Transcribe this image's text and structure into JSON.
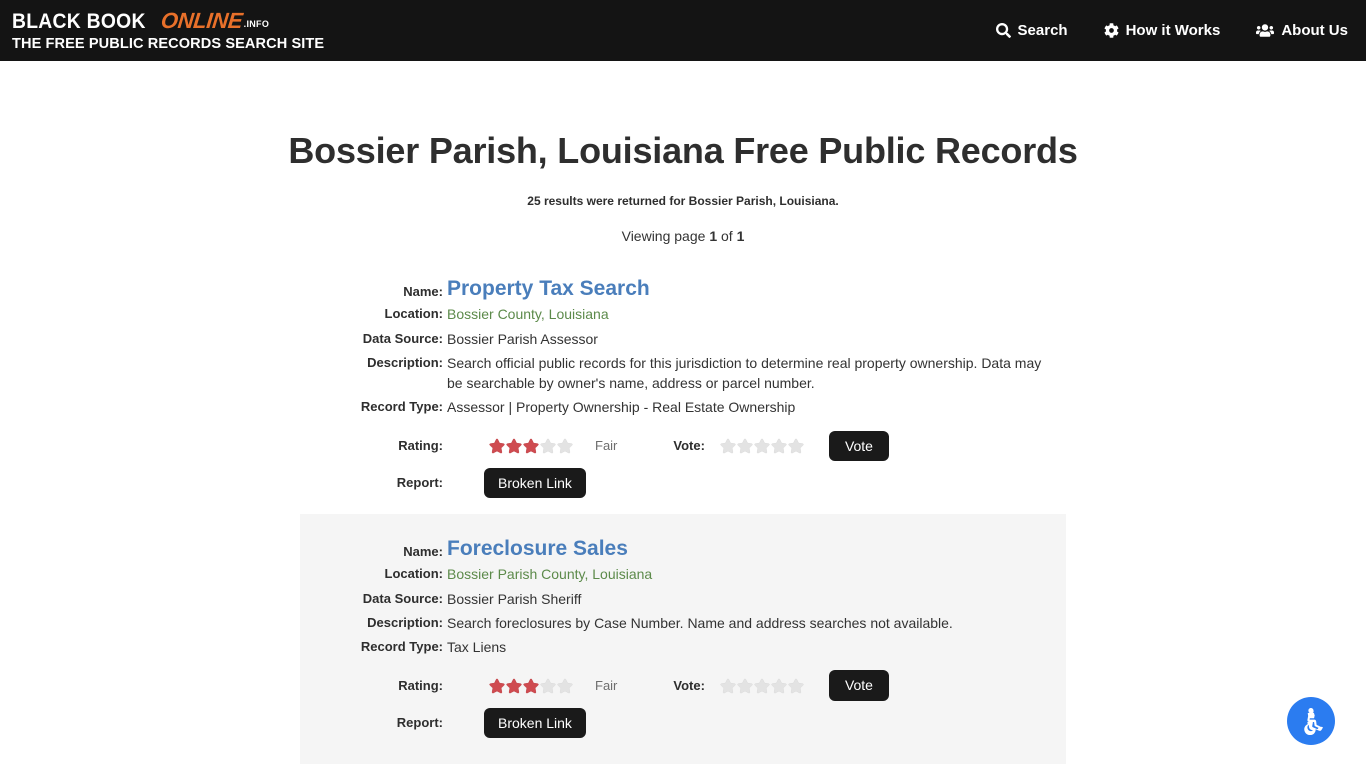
{
  "header": {
    "brand": {
      "word1": "BLACK BOOK",
      "word2": "ONLINE",
      "suffix": ".INFO",
      "tagline": "THE FREE PUBLIC RECORDS SEARCH SITE",
      "accent_color": "#e8702a",
      "background_color": "#141414"
    },
    "nav": [
      {
        "label": "Search",
        "icon": "search-icon"
      },
      {
        "label": "How it Works",
        "icon": "gear-icon"
      },
      {
        "label": "About Us",
        "icon": "users-icon"
      }
    ]
  },
  "main": {
    "title": "Bossier Parish, Louisiana Free Public Records",
    "result_count_text": "25 results were returned for Bossier Parish, Louisiana.",
    "paging": {
      "prefix": "Viewing page ",
      "current": "1",
      "middle": " of ",
      "total": "1"
    },
    "labels": {
      "name": "Name:",
      "location": "Location:",
      "data_source": "Data Source:",
      "description": "Description:",
      "record_type": "Record Type:",
      "rating": "Rating:",
      "vote": "Vote:",
      "report": "Report:"
    },
    "buttons": {
      "vote": "Vote",
      "broken_link": "Broken Link"
    },
    "colors": {
      "link_blue": "#4a7ebb",
      "location_green": "#5c8a4a",
      "star_filled": "#cf4b50",
      "star_empty": "#e3e3e3",
      "button_dark": "#1a1a1a",
      "alt_row_background": "#f5f5f5"
    },
    "records": [
      {
        "name": "Property Tax Search",
        "location": "Bossier County, Louisiana",
        "data_source": "Bossier Parish Assessor",
        "description": "Search official public records for this jurisdiction to determine real property ownership. Data may be searchable by owner's name, address or parcel number.",
        "record_type": "Assessor | Property Ownership - Real Estate Ownership",
        "rating_stars_filled": 3,
        "rating_stars_total": 5,
        "rating_word": "Fair",
        "vote_stars_filled": 0,
        "vote_stars_total": 5,
        "shaded": false
      },
      {
        "name": "Foreclosure Sales",
        "location": "Bossier Parish County, Louisiana",
        "data_source": "Bossier Parish Sheriff",
        "description": "Search foreclosures by Case Number. Name and address searches not available.",
        "record_type": "Tax Liens",
        "rating_stars_filled": 3,
        "rating_stars_total": 5,
        "rating_word": "Fair",
        "vote_stars_filled": 0,
        "vote_stars_total": 5,
        "shaded": true
      }
    ]
  },
  "accessibility_widget": {
    "icon": "wheelchair-icon",
    "color": "#2b7cf0"
  }
}
